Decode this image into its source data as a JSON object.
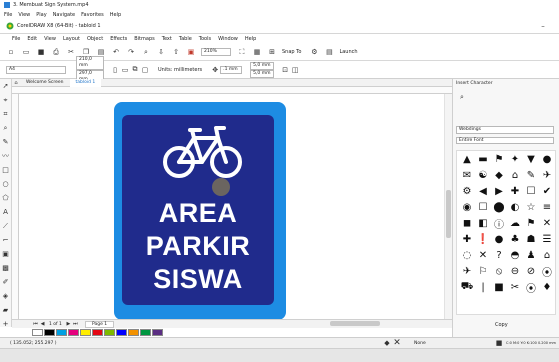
{
  "window": {
    "title": "3. Membuat Sign System.mp4",
    "player_menu": [
      "File",
      "View",
      "Play",
      "Navigate",
      "Favorites",
      "Help"
    ]
  },
  "app": {
    "title": "CorelDRAW X8 (64-Bit) - tabloid 1",
    "menu": [
      "File",
      "Edit",
      "View",
      "Layout",
      "Object",
      "Effects",
      "Bitmaps",
      "Text",
      "Table",
      "Tools",
      "Window",
      "Help"
    ],
    "toolbar": {
      "zoom": "210%",
      "snap_to": "Snap To",
      "launch": "Launch"
    },
    "propbar": {
      "page_size": "A4",
      "width": "210,0 mm",
      "height": "297,0 mm",
      "units_label": "Units: millimeters",
      "nudge": ".1 mm",
      "dup_x": "5,0 mm",
      "dup_y": "5,0 mm"
    },
    "tabs": [
      {
        "label": "Welcome Screen"
      },
      {
        "label": "tabloid 1"
      }
    ],
    "colors": {
      "accent": "#1e73c8",
      "sign_border": "#1d8ce3",
      "sign_fill": "#202b8c",
      "sign_text": "#ffffff"
    }
  },
  "canvas": {
    "sign_lines": [
      "AREA",
      "PARKIR",
      "SISWA"
    ],
    "sign_icon": "bicycle-icon"
  },
  "pagebar": {
    "counter": "1 of 1",
    "page_tab": "Page 1"
  },
  "palette": [
    "#ffffff",
    "#000000",
    "#00a0e3",
    "#e5007e",
    "#ffed00",
    "#e30613",
    "#7fba00",
    "#0000ff",
    "#f39200",
    "#009640",
    "#5a2d82"
  ],
  "statusbar": {
    "coords": "( 135.052; 255.297 )",
    "fill": "None",
    "color_info": "C:0 M:0 Y:0 K:100  0.200 mm"
  },
  "docker": {
    "title": "Insert Character",
    "font": "Webdings",
    "filter": "Entire Font",
    "copy_label": "Copy",
    "glyphs": [
      "▲",
      "▬",
      "⚑",
      "✦",
      "▼",
      "●",
      "✉",
      "☯",
      "◆",
      "⌂",
      "✎",
      "✈",
      "⚙",
      "◀",
      "▶",
      "✚",
      "☐",
      "✔",
      "◉",
      "☐",
      "⬤",
      "◐",
      "☆",
      "≡",
      "◼",
      "◧",
      "ⓘ",
      "☁",
      "⚑",
      "✕",
      "✚",
      "❗",
      "●",
      "♣",
      "☗",
      "☰",
      "◌",
      "✕",
      "?",
      "◓",
      "♟",
      "⌂",
      "✈",
      "⚐",
      "⦸",
      "⊖",
      "⊘",
      "⦿",
      "⛟",
      "|",
      "■",
      "✂",
      "⦿",
      "♦"
    ]
  }
}
